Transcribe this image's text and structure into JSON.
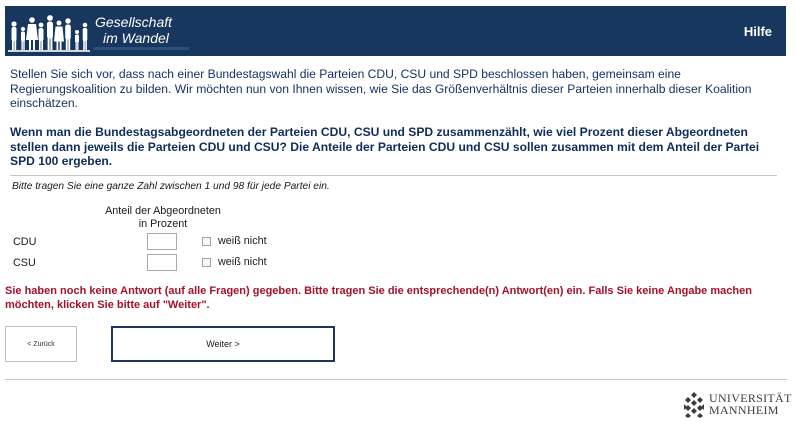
{
  "header": {
    "logo_line1": "Gesellschaft",
    "logo_line2": "im Wandel",
    "help_label": "Hilfe",
    "bg_color": "#17375e"
  },
  "intro_text": "Stellen Sie sich vor, dass nach einer Bundestagswahl die Parteien CDU, CSU und SPD beschlossen haben, gemeinsam eine Regierungskoalition zu bilden. Wir möchten nun von Ihnen wissen, wie Sie das Größenverhältnis dieser Parteien innerhalb dieser Koalition einschätzen.",
  "question_text": "Wenn man die Bundestagsabgeordneten der Parteien CDU, CSU und SPD zusammenzählt, wie viel Prozent dieser Abgeordneten stellen dann jeweils die Parteien CDU und CSU? Die Anteile der Parteien CDU und CSU sollen zusammen mit dem Anteil der Partei SPD 100 ergeben.",
  "hint_text": "Bitte tragen Sie eine ganze Zahl zwischen 1 und 98 für jede Partei ein.",
  "table": {
    "column_header_line1": "Anteil der Abgeordneten",
    "column_header_line2": "in Prozent",
    "rows": [
      {
        "label": "CDU",
        "value": "",
        "dont_know_label": "weiß nicht",
        "dont_know_checked": false
      },
      {
        "label": "CSU",
        "value": "",
        "dont_know_label": "weiß nicht",
        "dont_know_checked": false
      }
    ]
  },
  "error_text": "Sie haben noch keine Antwort (auf alle Fragen) gegeben. Bitte tragen Sie die entsprechende(n) Antwort(en) ein. Falls Sie keine Angabe machen möchten, klicken Sie bitte auf \"Weiter\".",
  "nav": {
    "back_label": "< Zurück",
    "next_label": "Weiter >"
  },
  "footer": {
    "uni_line1": "UNIVERSITÄT",
    "uni_line2": "MANNHEIM"
  },
  "colors": {
    "accent": "#17375e",
    "error": "#a5122a"
  }
}
